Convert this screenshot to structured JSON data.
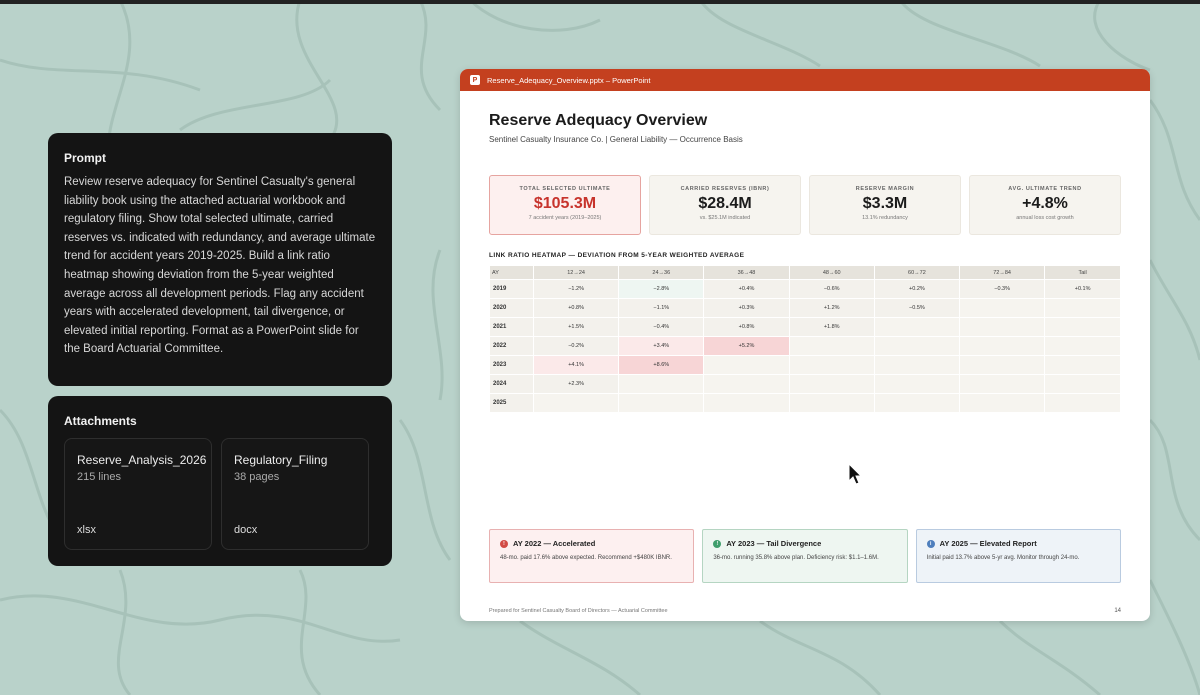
{
  "prompt": {
    "title": "Prompt",
    "text": "Review reserve adequacy for Sentinel Casualty's general liability book using the attached actuarial workbook and regulatory filing. Show total selected ultimate, carried reserves vs. indicated with redundancy, and average ultimate trend for accident years 2019-2025. Build a link ratio heatmap showing deviation from the 5-year weighted average across all development periods. Flag any accident years with accelerated development, tail divergence, or elevated initial reporting. Format as a PowerPoint slide for the Board Actuarial Committee."
  },
  "attachments": {
    "title": "Attachments",
    "files": [
      {
        "name": "Reserve_Analysis_2026",
        "meta": "215 lines",
        "ext": "xlsx"
      },
      {
        "name": "Regulatory_Filing",
        "meta": "38 pages",
        "ext": "docx"
      }
    ]
  },
  "window": {
    "title": "Reserve_Adequacy_Overview.pptx – PowerPoint",
    "icon": "P",
    "accent": "#c4401f"
  },
  "slide": {
    "title": "Reserve Adequacy Overview",
    "subtitle": "Sentinel Casualty Insurance Co.  |  General Liability — Occurrence Basis",
    "kpis": [
      {
        "label": "TOTAL SELECTED ULTIMATE",
        "value": "$105.3M",
        "note": "7 accident years (2019–2025)"
      },
      {
        "label": "CARRIED RESERVES (IBNR)",
        "value": "$28.4M",
        "note": "vs. $25.1M indicated"
      },
      {
        "label": "RESERVE MARGIN",
        "value": "$3.3M",
        "note": "13.1% redundancy"
      },
      {
        "label": "AVG. ULTIMATE TREND",
        "value": "+4.8%",
        "note": "annual loss cost growth"
      }
    ],
    "heatmap_title": "LINK RATIO HEATMAP — DEVIATION FROM 5-YEAR WEIGHTED AVERAGE",
    "heatmap": {
      "headers": [
        "AY",
        "12→24",
        "24→36",
        "36→48",
        "48→60",
        "60→72",
        "72→84",
        "Tail"
      ],
      "rows": [
        {
          "ay": "2019",
          "cells": [
            "−1.2%",
            "−2.8%",
            "+0.4%",
            "−0.6%",
            "+0.2%",
            "−0.3%",
            "+0.1%"
          ]
        },
        {
          "ay": "2020",
          "cells": [
            "+0.8%",
            "−1.1%",
            "+0.3%",
            "+1.2%",
            "−0.5%",
            "",
            ""
          ]
        },
        {
          "ay": "2021",
          "cells": [
            "+1.5%",
            "−0.4%",
            "+0.8%",
            "+1.8%",
            "",
            "",
            ""
          ]
        },
        {
          "ay": "2022",
          "cells": [
            "−0.2%",
            "+3.4%",
            "+5.2%",
            "",
            "",
            "",
            ""
          ]
        },
        {
          "ay": "2023",
          "cells": [
            "+4.1%",
            "+8.6%",
            "",
            "",
            "",
            "",
            ""
          ]
        },
        {
          "ay": "2024",
          "cells": [
            "+2.3%",
            "",
            "",
            "",
            "",
            "",
            ""
          ]
        },
        {
          "ay": "2025",
          "cells": [
            "",
            "",
            "",
            "",
            "",
            "",
            ""
          ]
        }
      ]
    },
    "flags": [
      {
        "title": "AY 2022 — Accelerated",
        "body": "48-mo. paid 17.6% above expected. Recommend +$480K IBNR.",
        "color": "#d24b45",
        "icon": "!"
      },
      {
        "title": "AY 2023 — Tail Divergence",
        "body": "36-mo. running 35.8% above plan. Deficiency risk: $1.1–1.6M.",
        "color": "#3f9e6c",
        "icon": "!"
      },
      {
        "title": "AY 2025 — Elevated Report",
        "body": "Initial paid 13.7% above 5-yr avg. Monitor through 24-mo.",
        "color": "#4f7fbd",
        "icon": "i"
      }
    ],
    "footer": "Prepared for Sentinel Casualty Board of Directors — Actuarial Committee",
    "page": "14"
  }
}
